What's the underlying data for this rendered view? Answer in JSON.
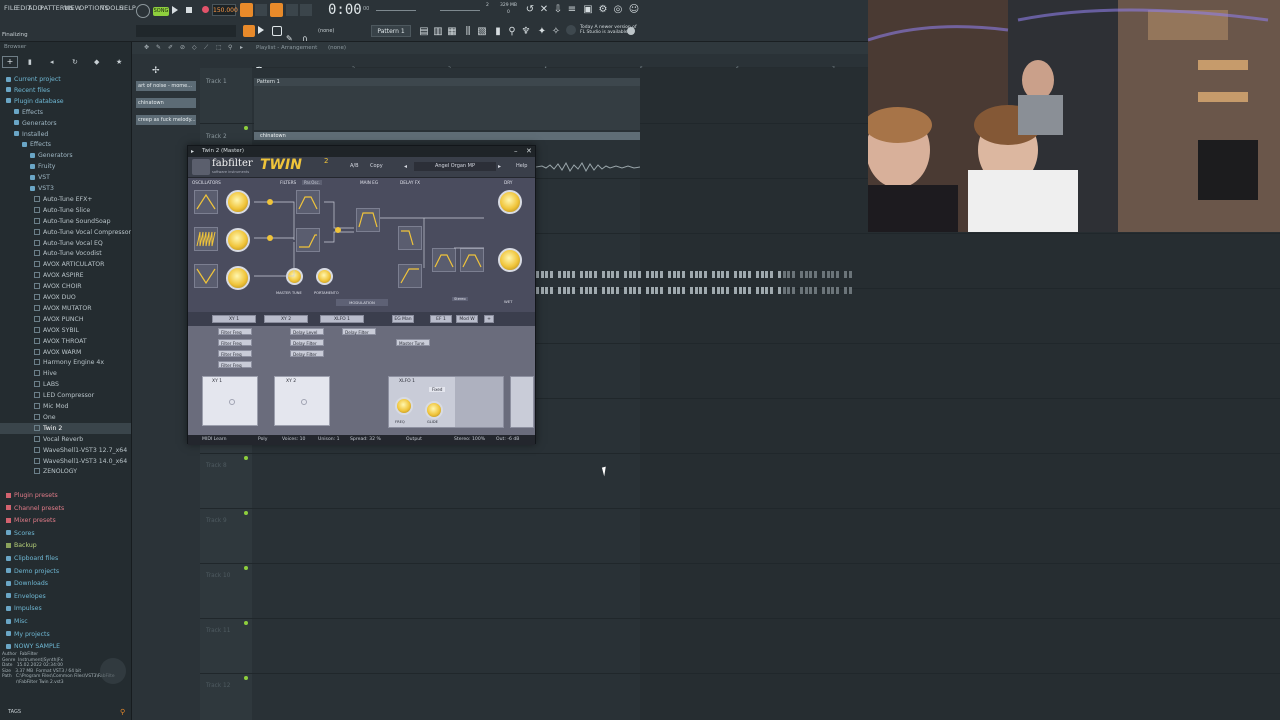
{
  "menu": [
    "FILE",
    "EDIT",
    "ADD",
    "PATTERNS",
    "VIEW",
    "OPTIONS",
    "TOOLS",
    "HELP"
  ],
  "transport": {
    "mode": "SONG",
    "tempo": "150.000",
    "time": "0:00",
    "time_sub": "00",
    "cpu_ram": "329 MB",
    "cpu_count": "0",
    "voices": "2",
    "pattern": "Pattern 1",
    "snap": "(none)"
  },
  "news": {
    "line1": "Today  A newer version of",
    "line2": "FL Studio is available!"
  },
  "hint_bar": "Finalizing",
  "browser": {
    "header": "Browser",
    "items": [
      {
        "label": "Current project",
        "kind": "hdr"
      },
      {
        "label": "Recent files",
        "kind": "hdr"
      },
      {
        "label": "Plugin database",
        "kind": "hdr"
      },
      {
        "label": "Effects",
        "kind": "cat"
      },
      {
        "label": "Generators",
        "kind": "cat"
      },
      {
        "label": "Installed",
        "kind": "cat"
      },
      {
        "label": "Effects",
        "kind": "cat"
      },
      {
        "label": "Generators",
        "kind": "cat"
      },
      {
        "label": "Fruity",
        "kind": "cat"
      },
      {
        "label": "VST",
        "kind": "cat"
      },
      {
        "label": "VST3",
        "kind": "cat"
      },
      {
        "label": "Auto-Tune EFX+",
        "kind": "item"
      },
      {
        "label": "Auto-Tune Slice",
        "kind": "item"
      },
      {
        "label": "Auto-Tune SoundSoap",
        "kind": "item"
      },
      {
        "label": "Auto-Tune Vocal Compressor",
        "kind": "item"
      },
      {
        "label": "Auto-Tune Vocal EQ",
        "kind": "item"
      },
      {
        "label": "Auto-Tune Vocodist",
        "kind": "item"
      },
      {
        "label": "AVOX ARTICULATOR",
        "kind": "item"
      },
      {
        "label": "AVOX ASPIRE",
        "kind": "item"
      },
      {
        "label": "AVOX CHOIR",
        "kind": "item"
      },
      {
        "label": "AVOX DUO",
        "kind": "item"
      },
      {
        "label": "AVOX MUTATOR",
        "kind": "item"
      },
      {
        "label": "AVOX PUNCH",
        "kind": "item"
      },
      {
        "label": "AVOX SYBIL",
        "kind": "item"
      },
      {
        "label": "AVOX THROAT",
        "kind": "item"
      },
      {
        "label": "AVOX WARM",
        "kind": "item"
      },
      {
        "label": "Harmony Engine 4x",
        "kind": "item"
      },
      {
        "label": "Hive",
        "kind": "item"
      },
      {
        "label": "LABS",
        "kind": "item"
      },
      {
        "label": "LED Compressor",
        "kind": "item"
      },
      {
        "label": "Mic Mod",
        "kind": "item"
      },
      {
        "label": "One",
        "kind": "item"
      },
      {
        "label": "Twin 2",
        "kind": "sel"
      },
      {
        "label": "Vocal Reverb",
        "kind": "item"
      },
      {
        "label": "WaveShell1-VST3 12.7_x64",
        "kind": "item"
      },
      {
        "label": "WaveShell1-VST3 14.0_x64",
        "kind": "item"
      },
      {
        "label": "ZENOLOGY",
        "kind": "item"
      }
    ],
    "folders": [
      {
        "label": "Plugin presets",
        "kind": "red"
      },
      {
        "label": "Channel presets",
        "kind": "red"
      },
      {
        "label": "Mixer presets",
        "kind": "red"
      },
      {
        "label": "Scores",
        "kind": "hdr"
      },
      {
        "label": "Backup",
        "kind": "green"
      },
      {
        "label": "Clipboard files",
        "kind": "folder"
      },
      {
        "label": "Demo projects",
        "kind": "folder"
      },
      {
        "label": "Downloads",
        "kind": "folder"
      },
      {
        "label": "Envelopes",
        "kind": "folder"
      },
      {
        "label": "Impulses",
        "kind": "folder"
      },
      {
        "label": "Misc",
        "kind": "folder"
      },
      {
        "label": "My projects",
        "kind": "folder"
      },
      {
        "label": "NOWY SAMPLE",
        "kind": "folder"
      }
    ],
    "info": {
      "author_k": "Author",
      "author_v": "FabFilter",
      "genre_k": "Genre",
      "genre_v": "Instrument|Synth|Fx",
      "date_k": "Date",
      "date_v": "15.02.2022 02:34:00",
      "size_k": "Size",
      "size_v": "3.37 MB",
      "format_k": "Format",
      "format_v": "VST3 / 64 bit",
      "path_k": "Path",
      "path_v": "C:\\Program Files\\Common Files\\VST3\\FabFilter\\FabFilter Twin 2.vst3"
    },
    "footer_tag": "TAGS"
  },
  "playlist": {
    "title": "Playlist - Arrangement",
    "title_sel": "(none)",
    "patterns": [
      "art of noise - mome...",
      "chinatown",
      "creep as fuck melody..."
    ],
    "ruler": [
      "1",
      "2",
      "3",
      "4",
      "5",
      "6",
      "7"
    ],
    "tracks": [
      "Track 1",
      "Track 2",
      "Track 8",
      "Track 9",
      "Track 10",
      "Track 11",
      "Track 12"
    ],
    "clip1": "Pattern 1",
    "clip2": "chinatown"
  },
  "plugin": {
    "window_title": "Twin 2 (Master)",
    "brand": "fabfilter",
    "brand_sub": "software instruments",
    "product": "TWIN",
    "product_ver": "2",
    "undo": "A/B",
    "copy": "Copy",
    "preset": "Angel Organ MP",
    "help": "Help",
    "sections": [
      "OSCILLATORS",
      "FILTERS",
      "MAIN EG",
      "DELAY FX",
      "DRY"
    ],
    "filter_mode": "Par.Osc.",
    "knob_labels": [
      "MASTER TUNE",
      "PORTAMENTO"
    ],
    "modulation": "MODULATION",
    "wet": "WET",
    "mod_tabs": [
      "XY 1",
      "XY 2",
      "XLFO 1",
      "EG Man",
      "EF 1",
      "Mod W"
    ],
    "mod_chips": [
      "Filter Freq",
      "Delay Level",
      "Delay Filter",
      "Filter Freq",
      "Delay Filter",
      "Master Tune",
      "Filter Freq",
      "Delay Filter",
      "Filter Freq"
    ],
    "xy_labels": [
      "XY 1",
      "XY 2",
      "XLFO 1"
    ],
    "lfo_labels": [
      "FREQ",
      "GLIDE"
    ],
    "lfo_mode": "Fixed",
    "status": [
      "MIDI Learn",
      "Poly",
      "Voices: 10",
      "Unison: 1",
      "Spread: 32 %",
      "Output",
      "Stereo: 100%",
      "Out: -6 dB"
    ]
  },
  "cursor": "arrow"
}
